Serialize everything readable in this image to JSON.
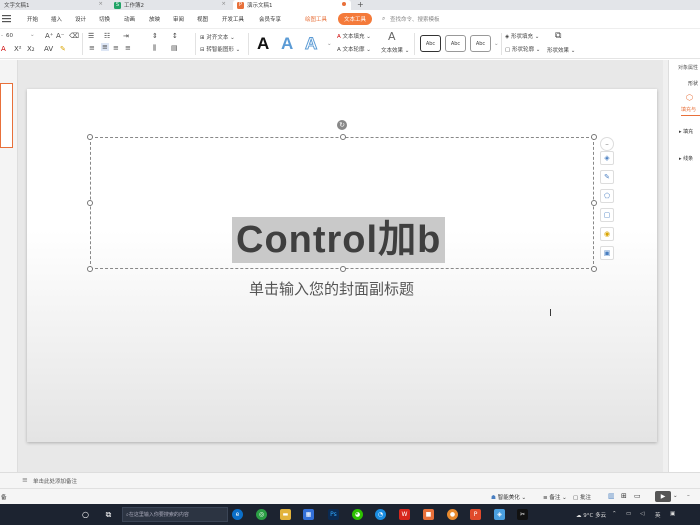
{
  "tabs": [
    {
      "label": "文字文稿1",
      "icon": "W",
      "color": "#3d7be0"
    },
    {
      "label": "工作簿2",
      "icon": "S",
      "color": "#21a366"
    },
    {
      "label": "演示文稿1",
      "icon": "P",
      "color": "#e8703a"
    }
  ],
  "new_tab": "+",
  "menu": [
    "开始",
    "插入",
    "设计",
    "切换",
    "动画",
    "放映",
    "审阅",
    "视图",
    "开发工具",
    "会员专享",
    "绘图工具",
    "文本工具"
  ],
  "search_placeholder": "查找命令、搜索模板",
  "ribbon": {
    "font_size": "60",
    "align_label": "对齐文本",
    "smartart_label": "转智能图形",
    "text_fill": "文本填充",
    "text_outline": "文本轮廓",
    "text_effect": "文本效果",
    "abc": "Abc",
    "shape_fill": "形状填充",
    "shape_outline": "形状轮廓",
    "shape_effect": "形状效果",
    "big_a": "A"
  },
  "slide": {
    "title": "Control加b",
    "subtitle": "单击输入您的封面副标题"
  },
  "right_panel": {
    "title": "对象属性",
    "shape": "形状",
    "tab": "填充与",
    "fill": "填充",
    "line": "线条"
  },
  "notes": "单击此处添加备注",
  "status": {
    "left": "备",
    "beautify": "智能美化",
    "notes_btn": "备注",
    "comment_btn": "批注"
  },
  "taskbar": {
    "search": "在这里输入你要搜索的内容",
    "weather": "9°C 多云",
    "lang": "英"
  },
  "colors": {
    "accent": "#e8703a",
    "wps_blue": "#3d7be0"
  }
}
